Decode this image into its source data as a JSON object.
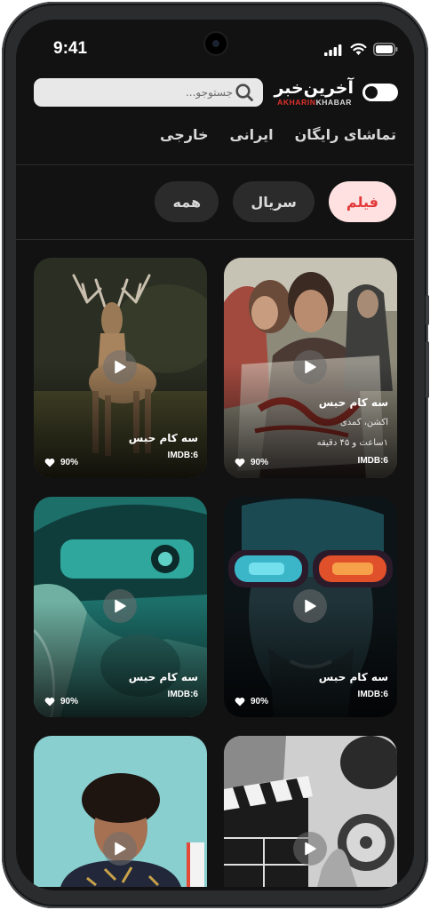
{
  "status_bar": {
    "time": "9:41"
  },
  "header": {
    "search": {
      "placeholder": "جستوجو..."
    },
    "logo": {
      "main": "آخرین‌خبر",
      "sub_red": "AKHARIN",
      "sub_white": "KHABAR"
    }
  },
  "nav": {
    "items": [
      "تماشای رایگان",
      "ایرانی",
      "خارجی"
    ]
  },
  "chips": {
    "items": [
      "فیلم",
      "سریال",
      "همه"
    ],
    "active": "فیلم"
  },
  "cards": [
    {
      "title": "سه کام حبس",
      "genre": "اکشن، کمدی",
      "duration": "۱ساعت و ۴۵ دقیقه",
      "imdb": "IMDB:6",
      "likes": "90%"
    },
    {
      "title": "سه کام حبس",
      "imdb": "IMDB:6",
      "likes": "90%"
    },
    {
      "title": "سه کام حبس",
      "imdb": "IMDB:6",
      "likes": "90%"
    },
    {
      "title": "سه کام حبس",
      "imdb": "IMDB:6",
      "likes": "90%"
    },
    {
      "title": "",
      "imdb": "",
      "likes": ""
    },
    {
      "title": "",
      "imdb": "",
      "likes": ""
    }
  ],
  "colors": {
    "accent": "#e2383a",
    "chip_active_bg": "#ffe1e1",
    "background": "#121212"
  }
}
